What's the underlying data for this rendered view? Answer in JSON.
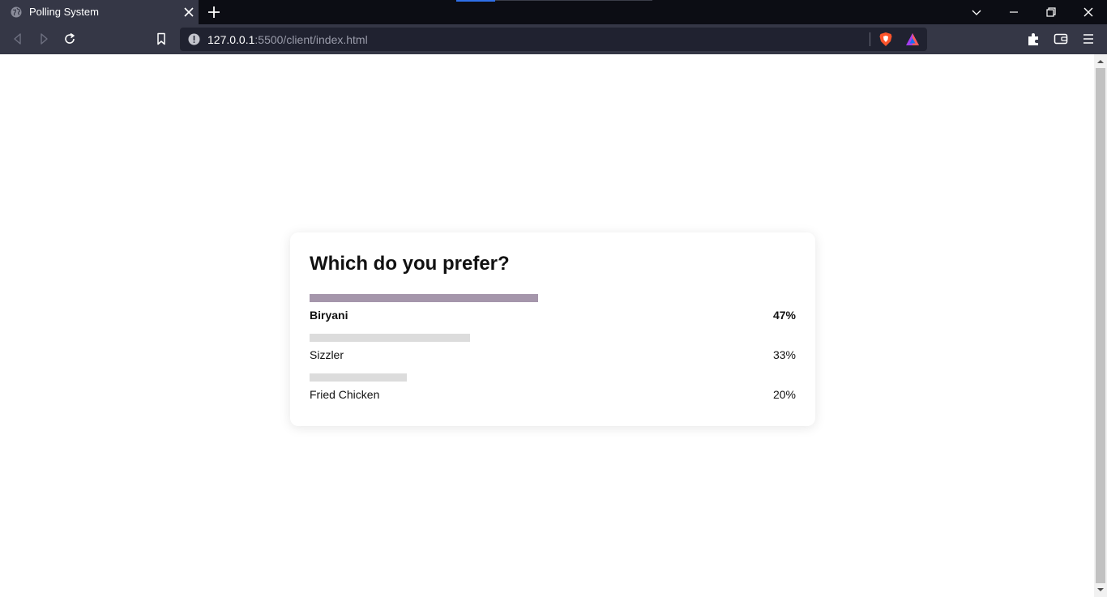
{
  "browser": {
    "tab": {
      "title": "Polling System"
    },
    "url": {
      "host": "127.0.0.1",
      "path": ":5500/client/index.html"
    }
  },
  "poll": {
    "question": "Which do you prefer?",
    "options": [
      {
        "label": "Biryani",
        "percent_text": "47%",
        "percent": 47,
        "winner": true
      },
      {
        "label": "Sizzler",
        "percent_text": "33%",
        "percent": 33,
        "winner": false
      },
      {
        "label": "Fried Chicken",
        "percent_text": "20%",
        "percent": 20,
        "winner": false
      }
    ]
  },
  "colors": {
    "winner_bar": "#a596ab",
    "other_bar": "#dcdcdc",
    "tab_active": "#353746",
    "tabbar_bg": "#0c0d14"
  },
  "icons": [
    "globe-icon",
    "close-icon",
    "plus-icon",
    "chevron-down-icon",
    "minimize-icon",
    "restore-icon",
    "back-icon",
    "forward-icon",
    "reload-icon",
    "bookmark-icon",
    "info-icon",
    "brave-shield-icon",
    "brave-rewards-icon",
    "extensions-icon",
    "wallet-icon",
    "menu-icon"
  ]
}
